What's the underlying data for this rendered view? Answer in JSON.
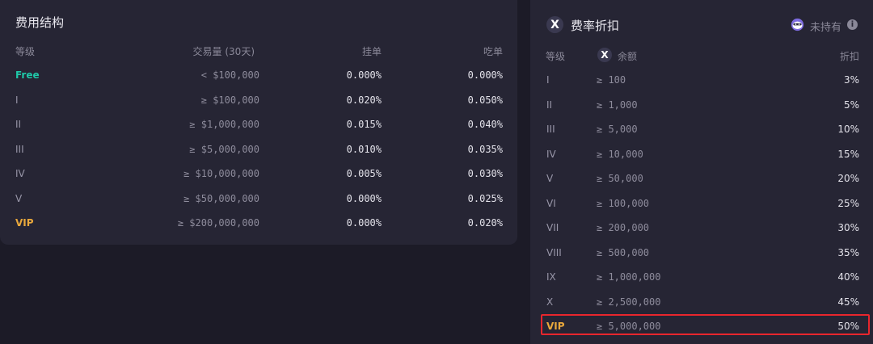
{
  "fee_structure": {
    "title": "费用结构",
    "headers": {
      "level": "等级",
      "volume": "交易量 (30天)",
      "maker": "挂单",
      "taker": "吃单"
    },
    "rows": [
      {
        "level": "Free",
        "volume": "< $100,000",
        "maker": "0.000%",
        "taker": "0.000%",
        "style": "free"
      },
      {
        "level": "I",
        "volume": "≥ $100,000",
        "maker": "0.020%",
        "taker": "0.050%"
      },
      {
        "level": "II",
        "volume": "≥ $1,000,000",
        "maker": "0.015%",
        "taker": "0.040%"
      },
      {
        "level": "III",
        "volume": "≥ $5,000,000",
        "maker": "0.010%",
        "taker": "0.035%"
      },
      {
        "level": "IV",
        "volume": "≥ $10,000,000",
        "maker": "0.005%",
        "taker": "0.030%"
      },
      {
        "level": "V",
        "volume": "≥ $50,000,000",
        "maker": "0.000%",
        "taker": "0.025%"
      },
      {
        "level": "VIP",
        "volume": "≥ $200,000,000",
        "maker": "0.000%",
        "taker": "0.020%",
        "style": "vip"
      }
    ]
  },
  "fee_discount": {
    "title": "费率折扣",
    "token_glyph": "X",
    "status": "未持有",
    "headers": {
      "level": "等级",
      "balance": "余额",
      "discount": "折扣"
    },
    "rows": [
      {
        "level": "I",
        "balance": "≥ 100",
        "discount": "3%"
      },
      {
        "level": "II",
        "balance": "≥ 1,000",
        "discount": "5%"
      },
      {
        "level": "III",
        "balance": "≥ 5,000",
        "discount": "10%"
      },
      {
        "level": "IV",
        "balance": "≥ 10,000",
        "discount": "15%"
      },
      {
        "level": "V",
        "balance": "≥ 50,000",
        "discount": "20%"
      },
      {
        "level": "VI",
        "balance": "≥ 100,000",
        "discount": "25%"
      },
      {
        "level": "VII",
        "balance": "≥ 200,000",
        "discount": "30%"
      },
      {
        "level": "VIII",
        "balance": "≥ 500,000",
        "discount": "35%"
      },
      {
        "level": "IX",
        "balance": "≥ 1,000,000",
        "discount": "40%"
      },
      {
        "level": "X",
        "balance": "≥ 2,500,000",
        "discount": "45%"
      },
      {
        "level": "VIP",
        "balance": "≥ 5,000,000",
        "discount": "50%",
        "style": "vip",
        "highlighted": true
      }
    ]
  },
  "colors": {
    "background": "#1c1b27",
    "panel": "#262534",
    "free_level": "#1fc7a8",
    "vip_level": "#e9a83c",
    "highlight_border": "#e8262d"
  },
  "icons": {
    "token": "x-token-icon",
    "mascot": "mascot-icon",
    "info": "info-icon"
  }
}
